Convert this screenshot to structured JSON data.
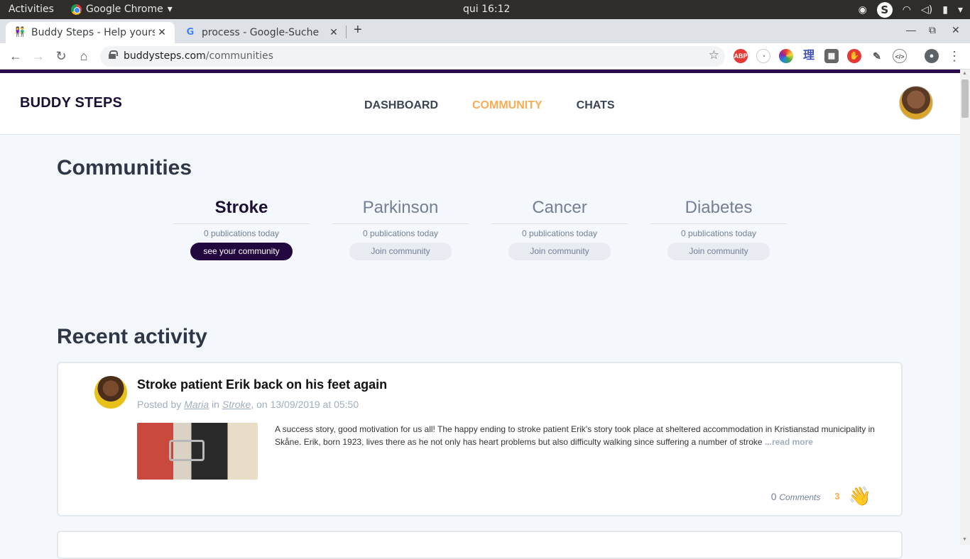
{
  "system": {
    "activities": "Activities",
    "app_name": "Google Chrome",
    "clock": "qui 16:12"
  },
  "browser": {
    "tabs": [
      {
        "title": "Buddy Steps - Help yourse",
        "active": true
      },
      {
        "title": "process - Google-Suche",
        "active": false
      }
    ],
    "url_host": "buddysteps.com",
    "url_path": "/communities"
  },
  "site": {
    "logo": "BUDDY STEPS",
    "nav": [
      {
        "label": "DASHBOARD",
        "active": false
      },
      {
        "label": "COMMUNITY",
        "active": true
      },
      {
        "label": "CHATS",
        "active": false
      }
    ]
  },
  "communities": {
    "heading": "Communities",
    "items": [
      {
        "name": "Stroke",
        "pubs": "0 publications today",
        "button": "see your community",
        "joined": true
      },
      {
        "name": "Parkinson",
        "pubs": "0 publications today",
        "button": "Join community",
        "joined": false
      },
      {
        "name": "Cancer",
        "pubs": "0 publications today",
        "button": "Join community",
        "joined": false
      },
      {
        "name": "Diabetes",
        "pubs": "0 publications today",
        "button": "Join community",
        "joined": false
      }
    ]
  },
  "recent": {
    "heading": "Recent activity",
    "post": {
      "title": "Stroke patient Erik back on his feet again",
      "meta_prefix": "Posted by",
      "author": "Maria",
      "meta_in": "in",
      "community": "Stroke",
      "meta_date": ", on 13/09/2019 at 05:50",
      "excerpt": "A success story, good motivation for us all! The happy ending to stroke patient Erik's story took place at sheltered accommodation in Kristianstad municipality in Skåne. Erik, born 1923, lives there as he not only has heart problems but also difficulty walking since suffering a number of stroke",
      "read_more": "...read more",
      "comment_count": "0",
      "comments_label": "Comments",
      "likes": "3"
    }
  },
  "colors": {
    "accent": "#f6ad55",
    "brand_dark": "#23083f"
  }
}
